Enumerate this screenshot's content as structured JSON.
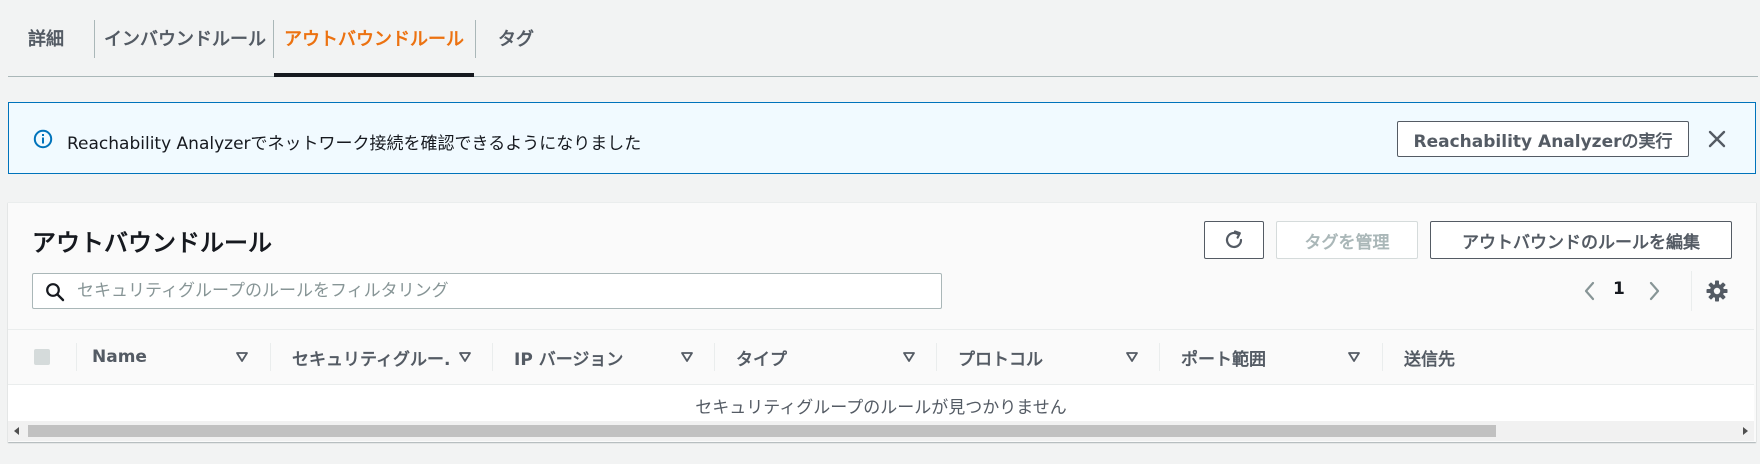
{
  "tabs": [
    {
      "label": "詳細"
    },
    {
      "label": "インバウンドルール"
    },
    {
      "label": "アウトバウンドルール",
      "active": true
    },
    {
      "label": "タグ"
    }
  ],
  "banner": {
    "text": "Reachability Analyzerでネットワーク接続を確認できるようになりました",
    "action_label": "Reachability Analyzerの実行",
    "icons": [
      "info-icon",
      "close-icon"
    ]
  },
  "panel": {
    "title": "アウトバウンドルール",
    "buttons": {
      "refresh_icon": "refresh-icon",
      "manage_tags": "タグを管理",
      "edit_outbound": "アウトバウンドのルールを編集"
    },
    "search": {
      "value": "",
      "placeholder": "セキュリティグループのルールをフィルタリング"
    },
    "pagination": {
      "current_page": "1"
    },
    "table": {
      "columns": [
        {
          "label": "Name"
        },
        {
          "label": "セキュリティグルー..."
        },
        {
          "label": "IP バージョン"
        },
        {
          "label": "タイプ"
        },
        {
          "label": "プロトコル"
        },
        {
          "label": "ポート範囲"
        },
        {
          "label": "送信先"
        }
      ],
      "empty_message": "セキュリティグループのルールが見つかりません"
    }
  },
  "colors": {
    "accent": "#ec7211",
    "info_border": "#0073bb",
    "info_bg": "#f1faff",
    "text": "#16191f",
    "muted": "#545b64"
  }
}
